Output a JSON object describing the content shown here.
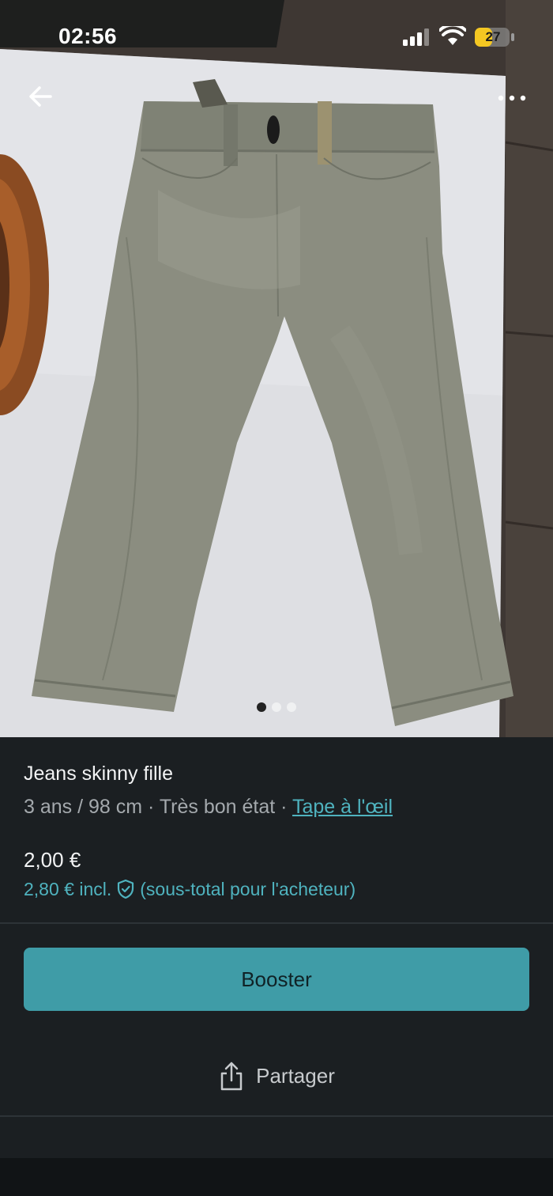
{
  "status_bar": {
    "time": "02:56",
    "battery": "27",
    "icons": [
      "signal-icon",
      "wifi-icon",
      "battery-icon"
    ]
  },
  "navigation": {
    "back_icon": "arrow-left-icon",
    "more_icon": "more-horizontal-icon"
  },
  "carousel": {
    "total": 3,
    "active": 1
  },
  "listing": {
    "title": "Jeans skinny fille",
    "size": "3 ans / 98 cm",
    "separator": " · ",
    "condition": "Très bon état",
    "brand": "Tape à l'œil",
    "price": "2,00 €",
    "price_incl": "2,80 € incl.",
    "price_incl_note": "(sous-total pour l'acheteur)"
  },
  "actions": {
    "booster_label": "Booster",
    "share_label": "Partager"
  },
  "colors": {
    "accent": "#3f9ca7",
    "link": "#4fb3bf",
    "background": "#1b1f22"
  }
}
